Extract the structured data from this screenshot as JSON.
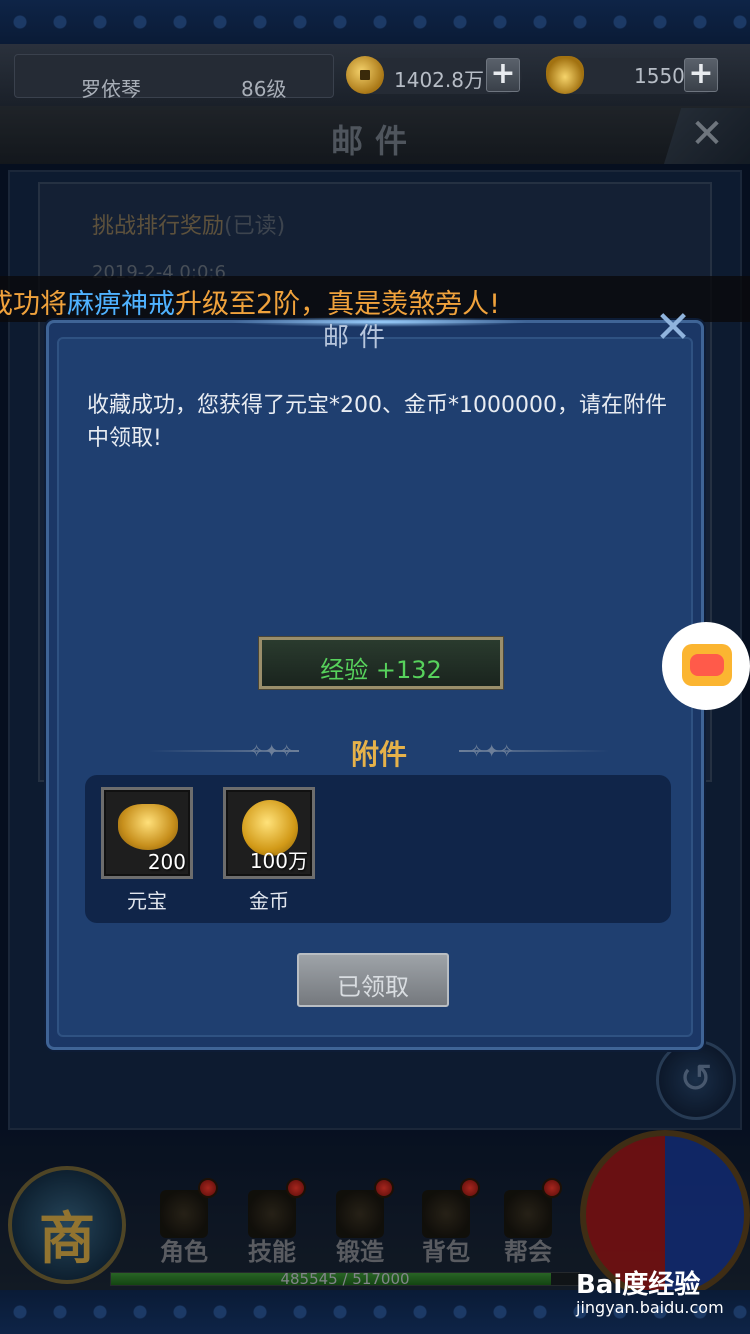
{
  "player": {
    "name": "罗依琴",
    "level": "86级",
    "coins": "1402.8万",
    "ingots": "1550",
    "plus": "+"
  },
  "mail": {
    "title": "邮件",
    "close": "✕",
    "item_title": "挑战排行奖励",
    "item_status": "(已读)",
    "item_date": "2019-2-4 0:0:6",
    "return": "↺"
  },
  "marquee": {
    "part1": "成功将",
    "part2": "麻痹神戒",
    "part3": "升级至2阶，真是羡煞旁人!"
  },
  "dialog": {
    "title": "邮件",
    "close": "✕",
    "message": "收藏成功，您获得了元宝*200、金币*1000000，请在附件中领取!",
    "exp": "经验 +132",
    "attachments_title": "附件",
    "ornament": "✧✦✧",
    "attachments": [
      {
        "name": "元宝",
        "qty": "200",
        "icon": "gold-ingot-icon"
      },
      {
        "name": "金币",
        "qty": "100万",
        "icon": "gold-coin-icon"
      }
    ],
    "claim_button": "已领取"
  },
  "hud": {
    "shop": "商",
    "nav": [
      {
        "label": "角色",
        "icon": "character-icon"
      },
      {
        "label": "技能",
        "icon": "skill-scroll-icon"
      },
      {
        "label": "锻造",
        "icon": "forge-icon"
      },
      {
        "label": "背包",
        "icon": "bag-icon"
      },
      {
        "label": "帮会",
        "icon": "guild-icon"
      }
    ],
    "xp_text": "485545 / 517000",
    "xp_current": 485545,
    "xp_max": 517000
  },
  "watermark": {
    "logo": "Bai度经验",
    "url": "jingyan.baidu.com"
  },
  "colors": {
    "accent_gold": "#e6b24a",
    "exp_green": "#57d25c",
    "marquee_orange": "#f0a23c",
    "marquee_blue": "#4fb2ff"
  }
}
